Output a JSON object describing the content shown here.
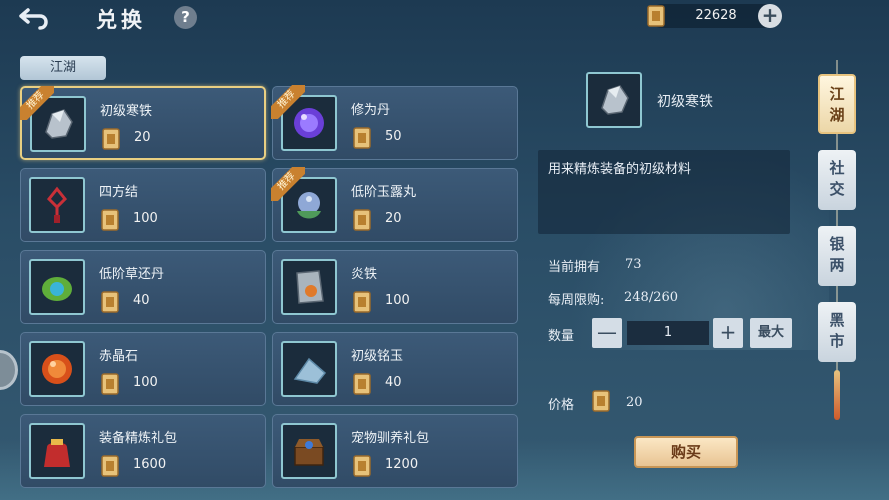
{
  "header": {
    "title": "兑换",
    "help_label": "?",
    "currency_amount": "22628",
    "add_label": "+"
  },
  "category_tab": "江湖",
  "items": [
    {
      "name": "初级寒铁",
      "price": "20",
      "recommended": true,
      "selected": true,
      "badge": "推荐",
      "icon": "iron-ore-icon"
    },
    {
      "name": "修为丹",
      "price": "50",
      "recommended": true,
      "badge": "推荐",
      "icon": "purple-pill-icon"
    },
    {
      "name": "四方结",
      "price": "100",
      "recommended": false,
      "icon": "red-knot-icon"
    },
    {
      "name": "低阶玉露丸",
      "price": "20",
      "recommended": true,
      "badge": "推荐",
      "icon": "jade-pill-icon"
    },
    {
      "name": "低阶草还丹",
      "price": "40",
      "recommended": false,
      "icon": "herb-pill-icon"
    },
    {
      "name": "炎铁",
      "price": "100",
      "recommended": false,
      "icon": "flame-iron-icon"
    },
    {
      "name": "赤晶石",
      "price": "100",
      "recommended": false,
      "icon": "red-crystal-icon"
    },
    {
      "name": "初级铭玉",
      "price": "40",
      "recommended": false,
      "icon": "jade-stone-icon"
    },
    {
      "name": "装备精炼礼包",
      "price": "1600",
      "recommended": false,
      "icon": "gift-bag-icon"
    },
    {
      "name": "宠物驯养礼包",
      "price": "1200",
      "recommended": false,
      "icon": "treasure-chest-icon"
    }
  ],
  "detail": {
    "name": "初级寒铁",
    "description": "用来精炼装备的初级材料",
    "owned_label": "当前拥有",
    "owned_value": "73",
    "limit_label": "每周限购:",
    "limit_value": "248/260",
    "qty_label": "数量",
    "qty_value": "1",
    "minus": "—",
    "plus": "+",
    "max_label": "最大",
    "price_label": "价格",
    "price_value": "20",
    "buy_label": "购买"
  },
  "side_tabs": [
    {
      "label": "江\n湖",
      "active": true
    },
    {
      "label": "社\n交",
      "active": false
    },
    {
      "label": "银\n两",
      "active": false
    },
    {
      "label": "黑\n市",
      "active": false
    }
  ],
  "colors": {
    "accent_gold": "#e9cf82",
    "ribbon": "#c9812f",
    "panel": "#3c5a78"
  }
}
